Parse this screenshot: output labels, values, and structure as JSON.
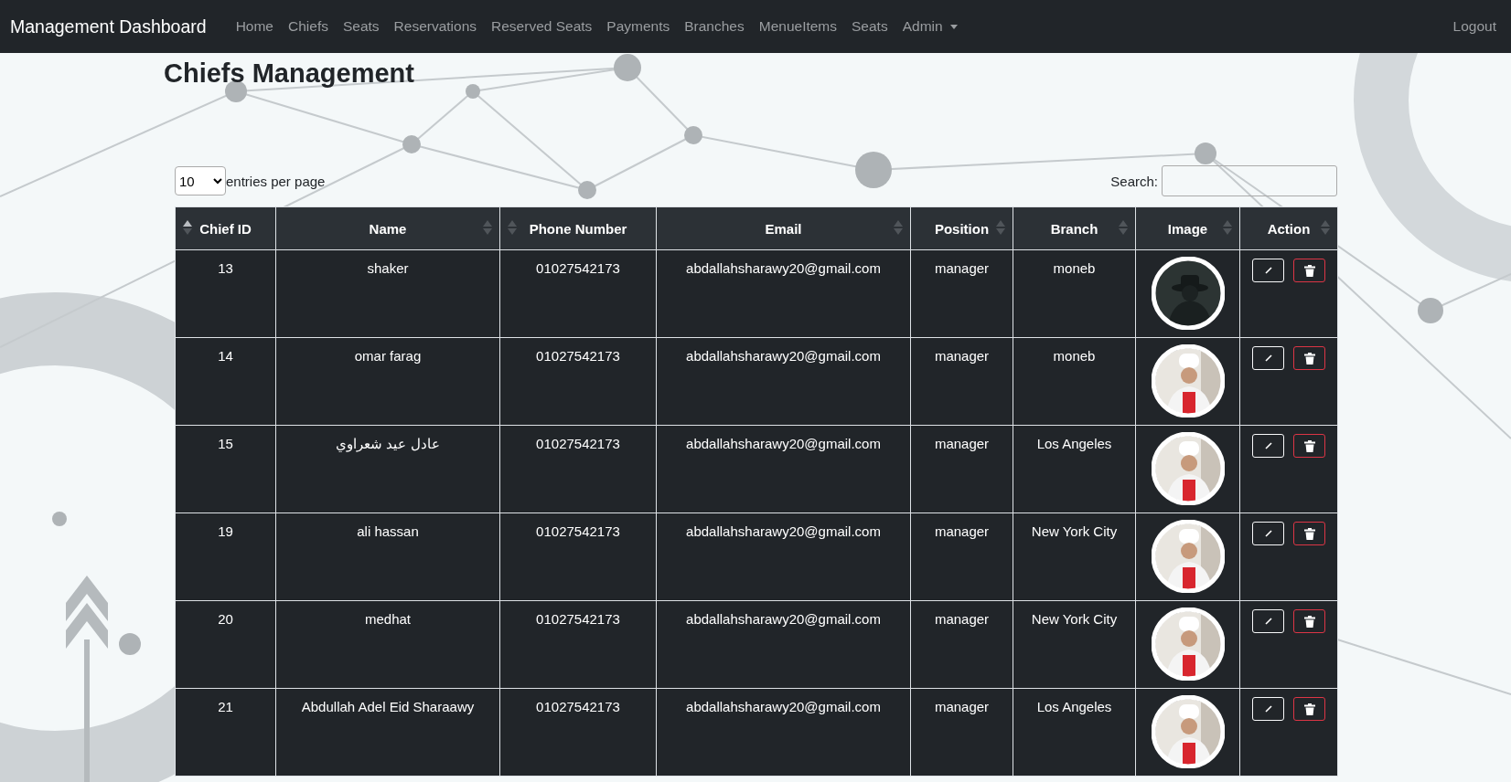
{
  "navbar": {
    "brand": "Management Dashboard",
    "links": [
      {
        "label": "Home",
        "dropdown": false
      },
      {
        "label": "Chiefs",
        "dropdown": false
      },
      {
        "label": "Seats",
        "dropdown": false
      },
      {
        "label": "Reservations",
        "dropdown": false
      },
      {
        "label": "Reserved Seats",
        "dropdown": false
      },
      {
        "label": "Payments",
        "dropdown": false
      },
      {
        "label": "Branches",
        "dropdown": false
      },
      {
        "label": "MenueItems",
        "dropdown": false
      },
      {
        "label": "Seats",
        "dropdown": false
      },
      {
        "label": "Admin",
        "dropdown": true
      }
    ],
    "logout": "Logout"
  },
  "page_title": "Chiefs Management",
  "table_controls": {
    "page_size": "10",
    "page_size_label": "entries per page",
    "search_label": "Search:"
  },
  "table": {
    "columns": [
      {
        "label": "Chief ID",
        "sorted": true
      },
      {
        "label": "Name",
        "sorted": false
      },
      {
        "label": "Phone Number",
        "sorted": false
      },
      {
        "label": "Email",
        "sorted": false
      },
      {
        "label": "Position",
        "sorted": false
      },
      {
        "label": "Branch",
        "sorted": false
      },
      {
        "label": "Image",
        "sorted": false
      },
      {
        "label": "Action",
        "sorted": false
      }
    ],
    "rows": [
      {
        "id": "13",
        "name": "shaker",
        "phone": "01027542173",
        "email": "abdallahsharawy20@gmail.com",
        "position": "manager",
        "branch": "moneb"
      },
      {
        "id": "14",
        "name": "omar farag",
        "phone": "01027542173",
        "email": "abdallahsharawy20@gmail.com",
        "position": "manager",
        "branch": "moneb"
      },
      {
        "id": "15",
        "name": "عادل عيد شعراوي",
        "phone": "01027542173",
        "email": "abdallahsharawy20@gmail.com",
        "position": "manager",
        "branch": "Los Angeles"
      },
      {
        "id": "19",
        "name": "ali hassan",
        "phone": "01027542173",
        "email": "abdallahsharawy20@gmail.com",
        "position": "manager",
        "branch": "New York City"
      },
      {
        "id": "20",
        "name": "medhat",
        "phone": "01027542173",
        "email": "abdallahsharawy20@gmail.com",
        "position": "manager",
        "branch": "New York City"
      },
      {
        "id": "21",
        "name": "Abdullah Adel Eid Sharaawy",
        "phone": "01027542173",
        "email": "abdallahsharawy20@gmail.com",
        "position": "manager",
        "branch": "Los Angeles"
      }
    ]
  }
}
